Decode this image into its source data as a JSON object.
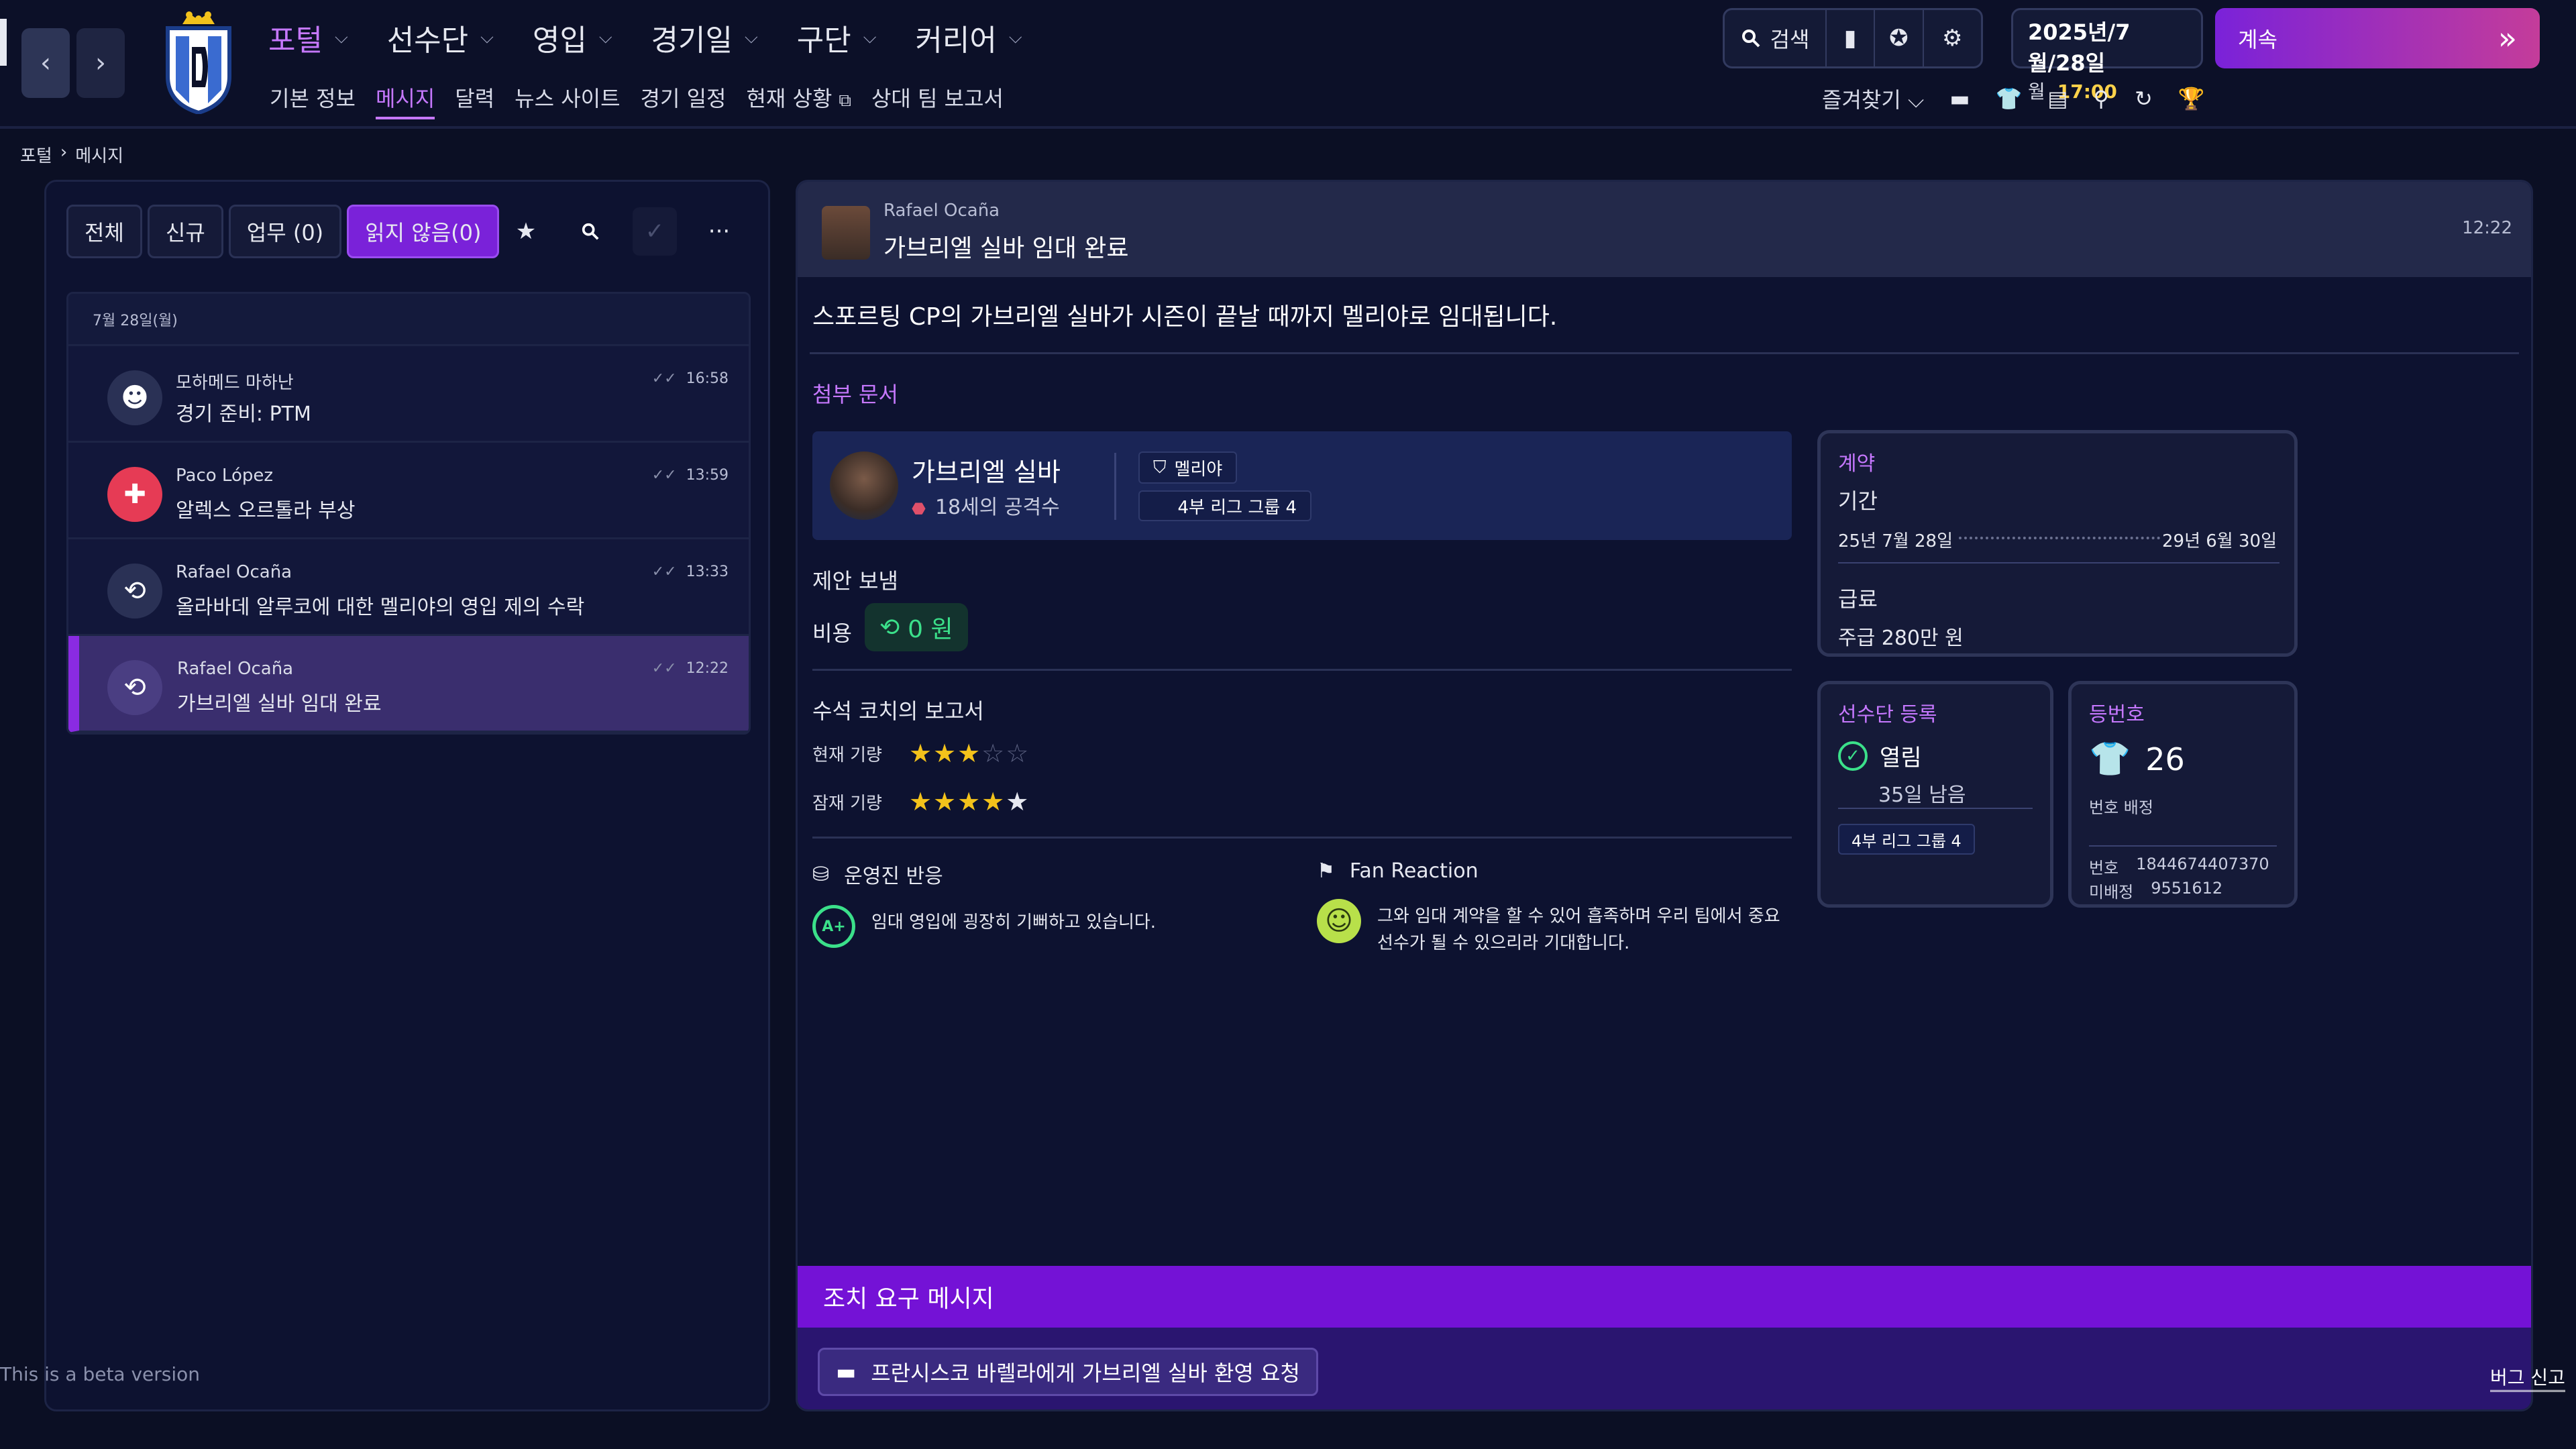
{
  "header": {
    "main_nav": [
      {
        "label": "포털"
      },
      {
        "label": "선수단"
      },
      {
        "label": "영입"
      },
      {
        "label": "경기일"
      },
      {
        "label": "구단"
      },
      {
        "label": "커리어"
      }
    ],
    "sub_nav": [
      "기본 정보",
      "메시지",
      "달력",
      "뉴스 사이트",
      "경기 일정",
      "현재 상황",
      "상대 팀 보고서"
    ],
    "search_label": "검색",
    "date_line": "2025년/7월/28일",
    "weekday": "월",
    "time": "17:00",
    "continue_label": "계속",
    "favorites_label": "즐겨찾기"
  },
  "breadcrumb": {
    "root": "포털",
    "current": "메시지"
  },
  "inbox": {
    "tabs": [
      "전체",
      "신규",
      "업무 (0)",
      "읽지 않음(0)"
    ],
    "date_header": "7월 28일(월)",
    "messages": [
      {
        "sender": "모하메드 마하난",
        "subject": "경기 준비: PTM",
        "time": "16:58",
        "icon": "group-icon"
      },
      {
        "sender": "Paco López",
        "subject": "알렉스 오르톨라 부상",
        "time": "13:59",
        "icon": "medical-cross-icon"
      },
      {
        "sender": "Rafael Ocaña",
        "subject": "올라바데 알루코에 대한 멜리야의 영입 제의 수락",
        "time": "13:33",
        "icon": "transfer-icon"
      },
      {
        "sender": "Rafael Ocaña",
        "subject": "가브리엘 실바 임대 완료",
        "time": "12:22",
        "icon": "transfer-icon"
      }
    ]
  },
  "detail": {
    "from": "Rafael Ocaña",
    "title": "가브리엘 실바 임대 완료",
    "time": "12:22",
    "body": "스포르팅 CP의 가브리엘 실바가 시즌이 끝날 때까지 멜리야로 임대됩니다.",
    "attachments_label": "첨부 문서",
    "player": {
      "name": "가브리엘 실바",
      "role": "18세의 공격수",
      "club": "멜리야",
      "league": "4부 리그 그룹 4"
    },
    "offer_label": "제안 보냄",
    "cost_label": "비용",
    "cost_value": "0 원",
    "coach_report_label": "수석 코치의 보고서",
    "current_ability_label": "현재 기량",
    "current_ability_stars": 3,
    "potential_ability_label": "잠재 기량",
    "potential_ability_stars": 4.5,
    "board_reaction": {
      "title": "운영진 반응",
      "grade": "A+",
      "text": "임대 영입에 굉장히 기뻐하고 있습니다."
    },
    "fan_reaction": {
      "title": "Fan Reaction",
      "text_line1": "그와 임대 계약을 할 수 있어 흡족하며 우리 팀에서 중요",
      "text_line2": "선수가 될 수 있으리라 기대합니다."
    },
    "contract": {
      "title": "계약",
      "period_label": "기간",
      "start": "25년 7월 28일",
      "end": "29년 6월 30일",
      "wage_label": "급료",
      "wage": "주급 280만 원"
    },
    "squad_registration": {
      "title": "선수단 등록",
      "status": "열림",
      "remaining": "35일 남음",
      "league": "4부 리그 그룹 4"
    },
    "squad_number": {
      "title": "등번호",
      "number": "26",
      "assign_label": "번호 배정",
      "number_label": "번호",
      "number_id": "1844674407370",
      "unassigned_label": "미배정",
      "unassigned_value": "9551612"
    },
    "action_header": "조치 요구 메시지",
    "action_button": "프란시스코 바렐라에게 가브리엘 실바 환영 요청"
  },
  "footer": {
    "beta_text": "This is a beta version",
    "bug_report": "버그 신고"
  },
  "colors": {
    "accent": "#c678ff",
    "action_purple": "#7412d6",
    "positive_green": "#3be08a",
    "star_gold": "#f3c21b"
  }
}
